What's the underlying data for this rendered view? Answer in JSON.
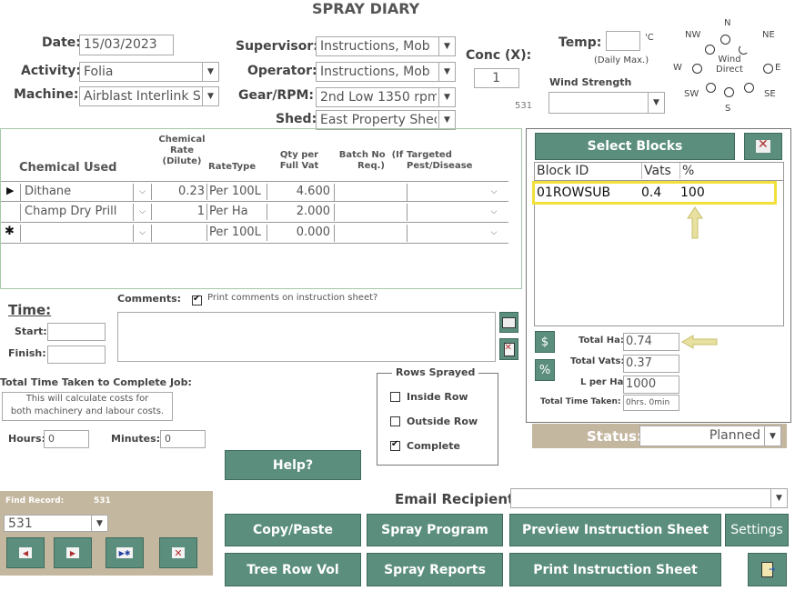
{
  "title": "SPRAY DIARY",
  "form": {
    "date_label": "Date:",
    "date_value": "15/03/2023",
    "activity_label": "Activity:",
    "activity_value": "Folia",
    "machine_label": "Machine:",
    "machine_value": "Airblast Interlink Sp",
    "supervisor_label": "Supervisor:",
    "supervisor_value": "Instructions, Mob",
    "operator_label": "Operator:",
    "operator_value": "Instructions, Mob",
    "gear_label": "Gear/RPM:",
    "gear_value": "2nd Low 1350 rpm",
    "shed_label": "Shed:",
    "shed_value": "East Property Shed",
    "conc_label": "Conc (X):",
    "conc_value": "1",
    "code_531": "531"
  },
  "weather": {
    "temp_label": "Temp:",
    "temp_unit": "'C",
    "temp_note": "(Daily Max.)",
    "temp_value": "",
    "wind_strength_label": "Wind Strength",
    "wind_strength_value": "",
    "wind_direct_label": "Wind\nDirect",
    "dirs": {
      "n": "N",
      "ne": "NE",
      "e": "E",
      "se": "SE",
      "s": "S",
      "sw": "SW",
      "w": "W",
      "nw": "NW"
    }
  },
  "chemicals": {
    "headers": {
      "chemical": "Chemical Used",
      "rate": "Chemical\nRate\n(Dilute)",
      "ratetype": "RateType",
      "qty": "Qty per\nFull Vat",
      "batch": "Batch No  (If\nReq.)",
      "pest": "Targeted\nPest/Disease"
    },
    "rows": [
      {
        "marker": "▶",
        "chemical": "Dithane",
        "rate": "0.23",
        "ratetype": "Per 100L",
        "qty": "4.600",
        "batch": "",
        "pest": ""
      },
      {
        "marker": "",
        "chemical": "Champ Dry Prill",
        "rate": "1",
        "ratetype": "Per Ha",
        "qty": "2.000",
        "batch": "",
        "pest": ""
      },
      {
        "marker": "✱",
        "chemical": "",
        "rate": "",
        "ratetype": "Per 100L",
        "qty": "0.000",
        "batch": "",
        "pest": ""
      }
    ]
  },
  "blocks": {
    "select_label": "Select Blocks",
    "headers": {
      "id": "Block ID",
      "vats": "Vats",
      "pct": "%"
    },
    "rows": [
      {
        "id": "01ROWSUB",
        "vats": "0.4",
        "pct": "100"
      }
    ],
    "total_ha_label": "Total Ha:",
    "total_ha_value": "0.74",
    "total_vats_label": "Total Vats:",
    "total_vats_value": "0.37",
    "lperha_label": "L per Ha:",
    "lperha_value": "1000",
    "total_time_label": "Total Time Taken:",
    "total_time_value": "0hrs. 0min",
    "dollar_label": "$",
    "percent_label": "%"
  },
  "status": {
    "label": "Status:",
    "value": "Planned"
  },
  "time": {
    "title": "Time:",
    "start_label": "Start:",
    "finish_label": "Finish:",
    "total_title": "Total Time Taken to Complete Job:",
    "note_line1": "This will calculate costs for",
    "note_line2": "both machinery and labour costs.",
    "hours_label": "Hours:",
    "hours_value": "0",
    "minutes_label": "Minutes:",
    "minutes_value": "0"
  },
  "comments": {
    "label": "Comments:",
    "print_label": "Print comments on instruction sheet?",
    "print_checked": true,
    "value": ""
  },
  "rows_sprayed": {
    "title": "Rows Sprayed",
    "inside": "Inside Row",
    "outside": "Outside Row",
    "complete": "Complete"
  },
  "find": {
    "label": "Find Record:",
    "code": "531",
    "value": "531"
  },
  "email": {
    "label": "Email Recipient:",
    "value": ""
  },
  "buttons": {
    "help": "Help?",
    "copy_paste": "Copy/Paste",
    "spray_program": "Spray Program",
    "preview": "Preview Instruction Sheet",
    "settings": "Settings",
    "tree_row_vol": "Tree Row Vol",
    "spray_reports": "Spray Reports",
    "print": "Print Instruction Sheet"
  },
  "colors": {
    "accent": "#5b8e7d",
    "highlight": "#f2e03a",
    "arrow": "#e8e0a0",
    "navpanel": "#c4b7a0",
    "status": "#c4b7a0"
  }
}
